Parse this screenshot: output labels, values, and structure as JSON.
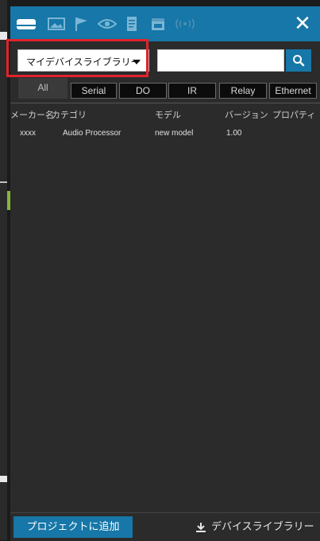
{
  "toolbar": {
    "icons": [
      "device-icon",
      "image-icon",
      "flag-icon",
      "eye-icon",
      "document-icon",
      "calendar-icon",
      "broadcast-icon"
    ],
    "close_label": "✕"
  },
  "library_selector": {
    "selected": "マイデバイスライブラリー"
  },
  "search": {
    "value": "",
    "placeholder": ""
  },
  "filter_tabs": [
    "All",
    "Serial",
    "DO",
    "IR",
    "Relay",
    "Ethernet"
  ],
  "table": {
    "columns": [
      "メーカー名",
      "カテゴリ",
      "モデル",
      "バージョン",
      "プロパティ"
    ],
    "rows": [
      [
        "xxxx",
        "Audio Processor",
        "new model",
        "1.00",
        ""
      ]
    ]
  },
  "footer": {
    "add_to_project": "プロジェクトに追加",
    "device_library": "デバイスライブラリー"
  },
  "colors": {
    "accent": "#1677a8",
    "panel": "#2b2b2b",
    "highlight": "#e0232b"
  }
}
